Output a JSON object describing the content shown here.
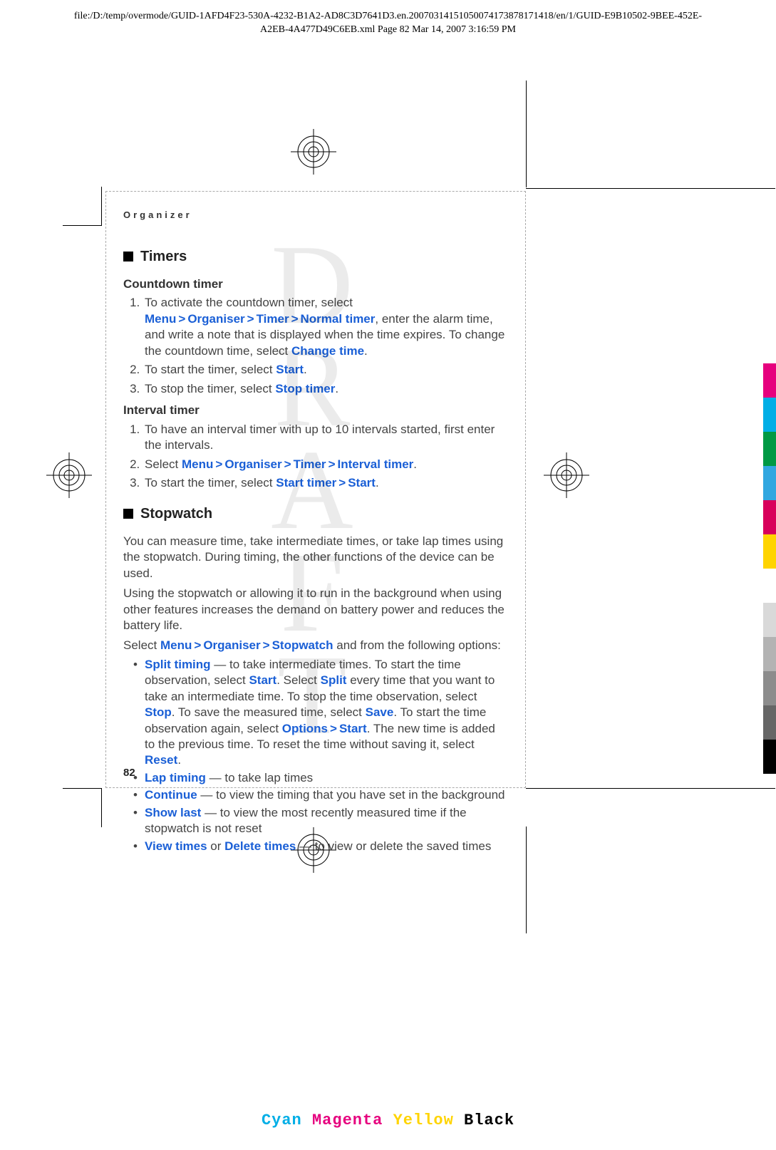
{
  "header": {
    "path_line1": "file:/D:/temp/overmode/GUID-1AFD4F23-530A-4232-B1A2-AD8C3D7641D3.en.20070314151050074173878171418/en/1/GUID-E9B10502-9BEE-452E-",
    "path_line2": "A2EB-4A477D49C6EB.xml        Page 82        Mar 14, 2007 3:16:59 PM"
  },
  "section_label": "Organizer",
  "timers": {
    "heading": "Timers",
    "sub1": "Countdown timer",
    "ol1": {
      "i1a": "To activate the countdown timer, select ",
      "i1b": ", enter the alarm time, and write a note that is displayed when the time expires. To change the countdown time, select ",
      "i1c": ".",
      "i2a": "To start the timer, select ",
      "i2b": ".",
      "i3a": "To stop the timer, select ",
      "i3b": "."
    },
    "sub2": "Interval timer",
    "ol2": {
      "i1": "To have an interval timer with up to 10 intervals started, first enter the intervals.",
      "i2a": "Select ",
      "i2b": ".",
      "i3a": "To start the timer, select ",
      "i3b": "."
    }
  },
  "stopwatch": {
    "heading": "Stopwatch",
    "p1": "You can measure time, take intermediate times, or take lap times using the stopwatch. During timing, the other functions of the device can be used.",
    "p2": "Using the stopwatch or allowing it to run in the background when using other features increases the demand on battery power and reduces the battery life.",
    "p3a": "Select ",
    "p3b": " and from the following options:",
    "b1a": " — to take intermediate times. To start the time observation, select ",
    "b1b": ". Select ",
    "b1c": " every time that you want to take an intermediate time. To stop the time observation, select ",
    "b1d": ". To save the measured time, select ",
    "b1e": ". To start the time observation again, select ",
    "b1f": ". The new time is added to the previous time. To reset the time without saving it, select ",
    "b1g": ".",
    "b2": " — to take lap times",
    "b3": " — to view the timing that you have set in the background",
    "b4": " — to view the most recently measured time if the stopwatch is not reset",
    "b5mid": " or ",
    "b5end": " — to view or delete the saved times"
  },
  "kw": {
    "menu": "Menu",
    "organiser": "Organiser",
    "timer": "Timer",
    "normal_timer": "Normal timer",
    "change_time": "Change time",
    "start": "Start",
    "stop_timer": "Stop timer",
    "interval_timer": "Interval timer",
    "start_timer": "Start timer",
    "stopwatch": "Stopwatch",
    "split_timing": "Split timing",
    "split": "Split",
    "stop": "Stop",
    "save": "Save",
    "options": "Options",
    "reset": "Reset",
    "lap_timing": "Lap timing",
    "continue": "Continue",
    "show_last": "Show last",
    "view_times": "View times",
    "delete_times": "Delete times",
    "gt": ">"
  },
  "page_number": "82",
  "footer": {
    "cyan": "Cyan",
    "magenta": "Magenta",
    "yellow": "Yellow",
    "black": "Black"
  },
  "colorbar_colors": [
    "#e6007e",
    "#00aee6",
    "#009944",
    "#31a7e0",
    "#d8005b",
    "#ffd400",
    "#ffffff",
    "#d9d9d9",
    "#b3b3b3",
    "#8c8c8c",
    "#666666",
    "#000000"
  ]
}
